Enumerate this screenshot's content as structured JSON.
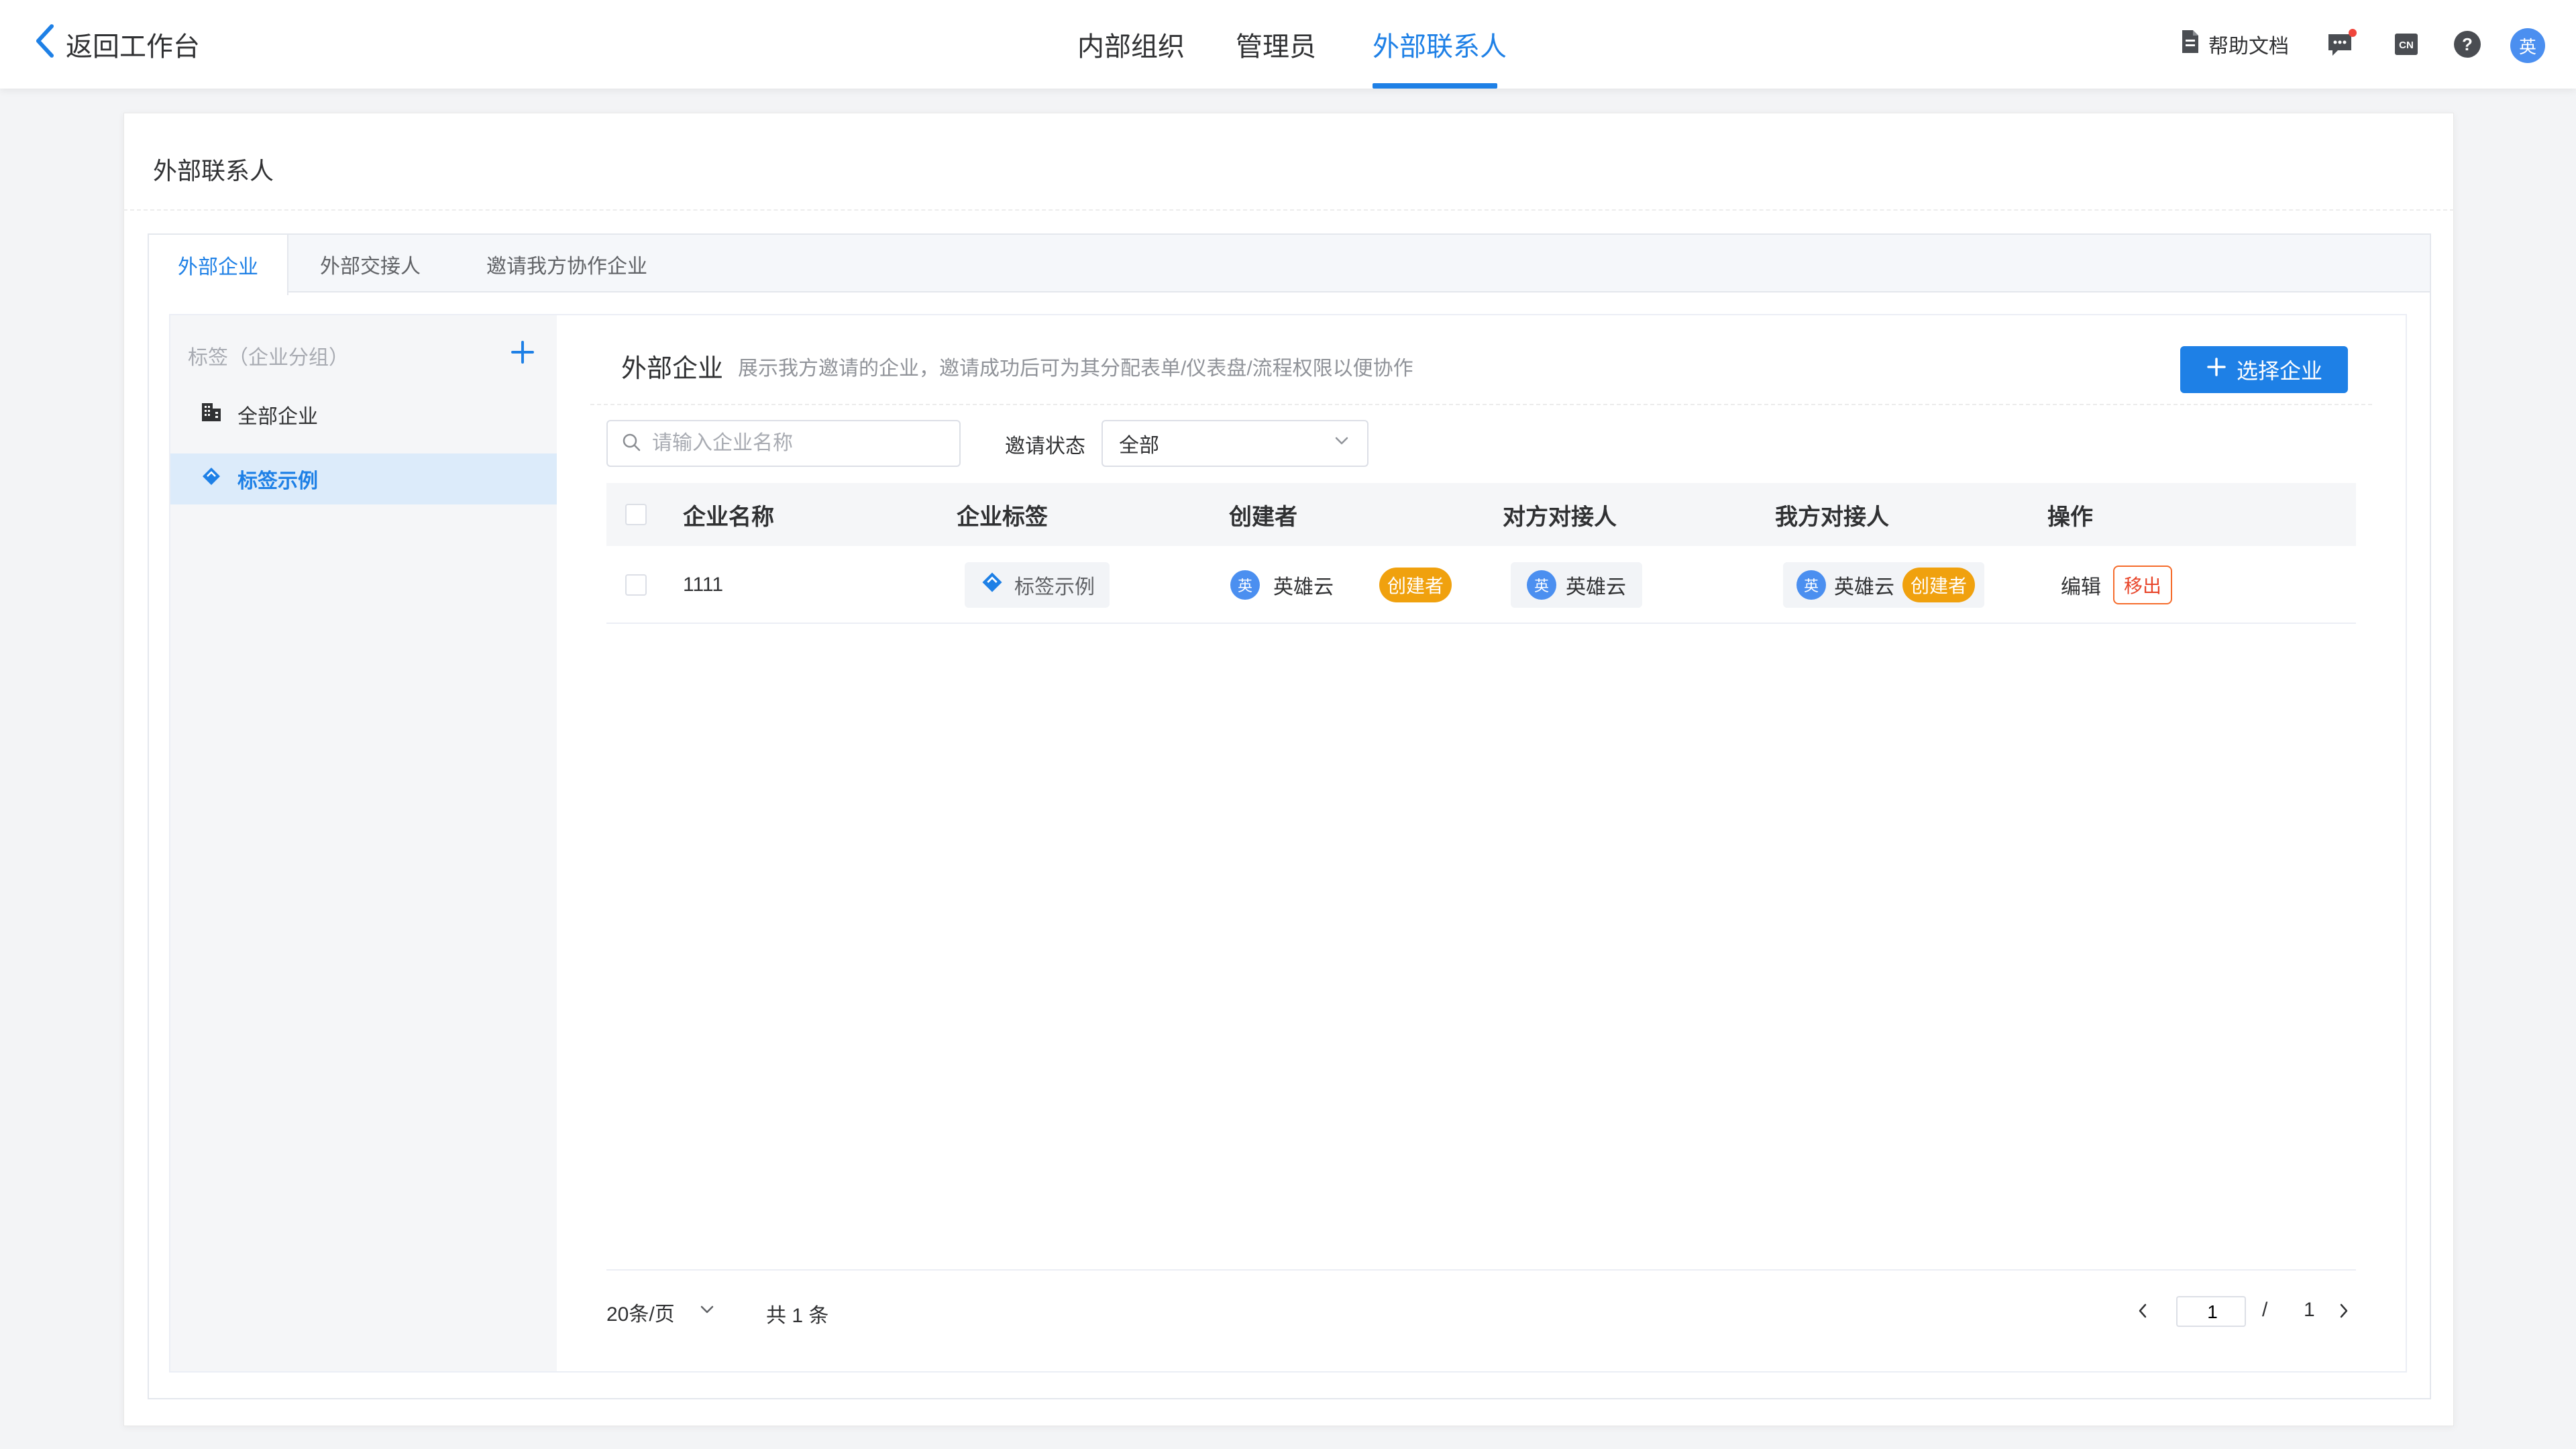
{
  "header": {
    "back_label": "返回工作台",
    "nav_tabs": [
      {
        "label": "内部组织"
      },
      {
        "label": "管理员"
      },
      {
        "label": "外部联系人"
      }
    ],
    "active_nav": "外部联系人",
    "help_label": "帮助文档",
    "lang_icon_text": "CN",
    "help_icon_text": "?",
    "avatar_text": "英",
    "colors": {
      "accent": "#1e80e6",
      "notify_dot": "#f0463c"
    }
  },
  "page": {
    "title": "外部联系人",
    "tabs": [
      {
        "label": "外部企业"
      },
      {
        "label": "外部交接人"
      },
      {
        "label": "邀请我方协作企业"
      }
    ]
  },
  "sidebar": {
    "title": "标签（企业分组）",
    "items": [
      {
        "label": "全部企业",
        "icon": "building-icon"
      },
      {
        "label": "标签示例",
        "icon": "tag-icon"
      }
    ]
  },
  "content": {
    "section_title": "外部企业",
    "section_desc": "展示我方邀请的企业，邀请成功后可为其分配表单/仪表盘/流程权限以便协作",
    "select_button": "选择企业",
    "search_placeholder": "请输入企业名称",
    "search_value": "",
    "status_label": "邀请状态",
    "status_value": "全部"
  },
  "table": {
    "columns": [
      "企业名称",
      "企业标签",
      "创建者",
      "对方对接人",
      "我方对接人",
      "操作"
    ],
    "rows": [
      {
        "name": "1111",
        "tag": "标签示例",
        "creator": "英雄云",
        "creator_badge": "创建者",
        "their_contact": "英雄云",
        "our_contact": "英雄云",
        "our_badge": "创建者",
        "avatar_text": "英",
        "actions": {
          "edit": "编辑",
          "remove": "移出"
        }
      }
    ]
  },
  "pagination": {
    "page_size": "20条/页",
    "total_text": "共 1 条",
    "current_page": "1",
    "separator": "/",
    "total_pages": "1"
  }
}
